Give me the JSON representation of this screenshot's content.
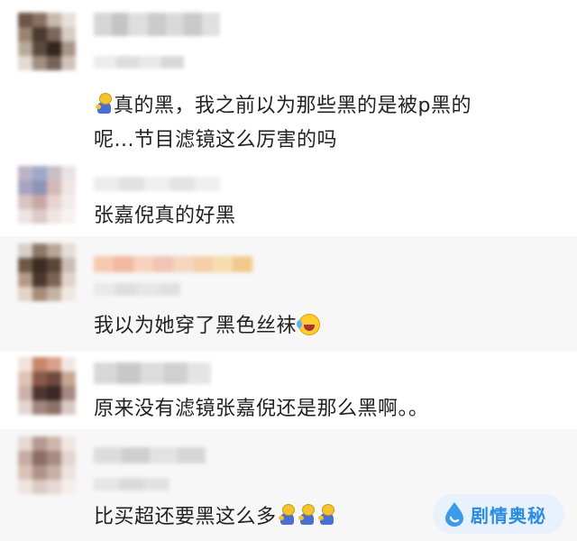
{
  "comments": [
    {
      "text_line1": "真的黑，我之前以为那些黑的是被p黑的",
      "text_line2": "呢...节目滤镜这么厉害的吗"
    },
    {
      "text": "张嘉倪真的好黑"
    },
    {
      "text": "我以为她穿了黑色丝袜"
    },
    {
      "text": "原来没有滤镜张嘉倪还是那么黑啊。。"
    },
    {
      "text": "比买超还要黑这么多"
    }
  ],
  "emoji": {
    "prayer": "prayer-emoji-icon",
    "laugh_cry": "laugh-cry-emoji-icon"
  },
  "watermark": {
    "text": "剧情奥秘"
  },
  "colors": {
    "highlight_row": "#f7f7f7",
    "text": "#222222",
    "watermark": "#2b8ce0"
  }
}
